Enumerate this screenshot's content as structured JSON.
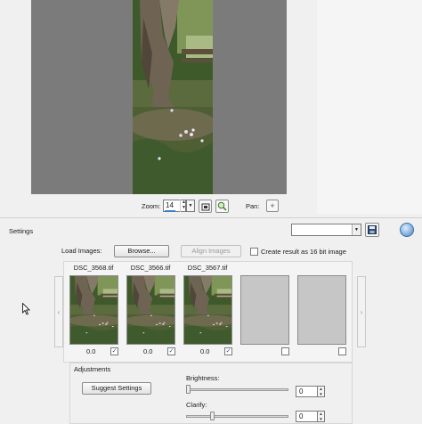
{
  "preview": {
    "zoom_label": "Zoom:",
    "zoom_value": "14",
    "pan_label": "Pan:",
    "pan_icon": "+"
  },
  "settings": {
    "label": "Settings",
    "select_value": ""
  },
  "load": {
    "label": "Load Images:",
    "browse_label": "Browse...",
    "align_label": "Align Images",
    "sixteen_bit_label": "Create result as 16 bit image"
  },
  "thumbnails": [
    {
      "name": "DSC_3568.tif",
      "value": "0.0",
      "checked": "✓"
    },
    {
      "name": "DSC_3566.tif",
      "value": "0.0",
      "checked": "✓"
    },
    {
      "name": "DSC_3567.tif",
      "value": "0.0",
      "checked": "✓"
    },
    {
      "name": "",
      "value": "",
      "checked": ""
    },
    {
      "name": "",
      "value": "",
      "checked": ""
    }
  ],
  "nav": {
    "prev": "‹",
    "next": "›"
  },
  "adjustments": {
    "title": "Adjustments",
    "suggest_label": "Suggest Settings",
    "brightness_label": "Brightness:",
    "brightness_value": "0",
    "clarify_label": "Clarify:",
    "clarify_value": "0"
  },
  "colors": {
    "preview_gray": "#7b7b7b",
    "placeholder_gray": "#c6c6c6",
    "accent": "#3c7fd1"
  }
}
